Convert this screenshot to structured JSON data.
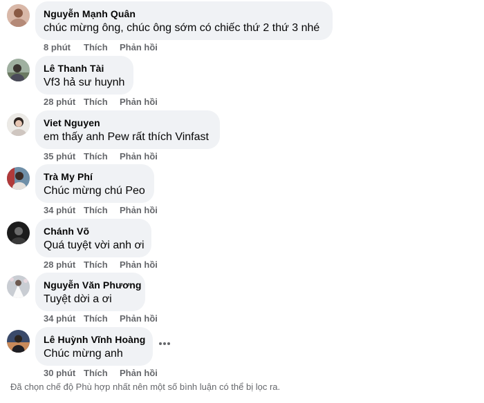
{
  "comments": [
    {
      "author": "Nguyễn Mạnh Quân",
      "text": "chúc mừng ông, chúc ông sớm có chiếc thứ 2 thứ 3 nhé",
      "time": "8 phút",
      "like": "Thích",
      "reply": "Phản hồi"
    },
    {
      "author": "Lê Thanh Tài",
      "text": "Vf3 hả sư huynh",
      "time": "28 phút",
      "like": "Thích",
      "reply": "Phản hồi"
    },
    {
      "author": "Viet Nguyen",
      "text": "em thấy anh Pew rất thích Vinfast",
      "time": "35 phút",
      "like": "Thích",
      "reply": "Phản hồi"
    },
    {
      "author": "Trà My Phí",
      "text": "Chúc mừng chú Peo",
      "time": "34 phút",
      "like": "Thích",
      "reply": "Phản hồi"
    },
    {
      "author": "Chánh Võ",
      "text": "Quá tuyệt vời anh ơi",
      "time": "28 phút",
      "like": "Thích",
      "reply": "Phản hồi"
    },
    {
      "author": "Nguyễn Văn Phương",
      "text": "Tuyệt dời a ơi",
      "time": "34 phút",
      "like": "Thích",
      "reply": "Phản hồi"
    },
    {
      "author": "Lê Huỳnh Vĩnh Hoàng",
      "text": "Chúc mừng anh",
      "time": "30 phút",
      "like": "Thích",
      "reply": "Phản hồi"
    }
  ],
  "more_options_icon": "more-horizontal-icon",
  "footer_note": "Đã chọn chế độ Phù hợp nhất nên một số bình luận có thể bị lọc ra.",
  "colors": {
    "bubble_bg": "#f0f2f5",
    "text": "#050505",
    "secondary_text": "#65676b"
  }
}
